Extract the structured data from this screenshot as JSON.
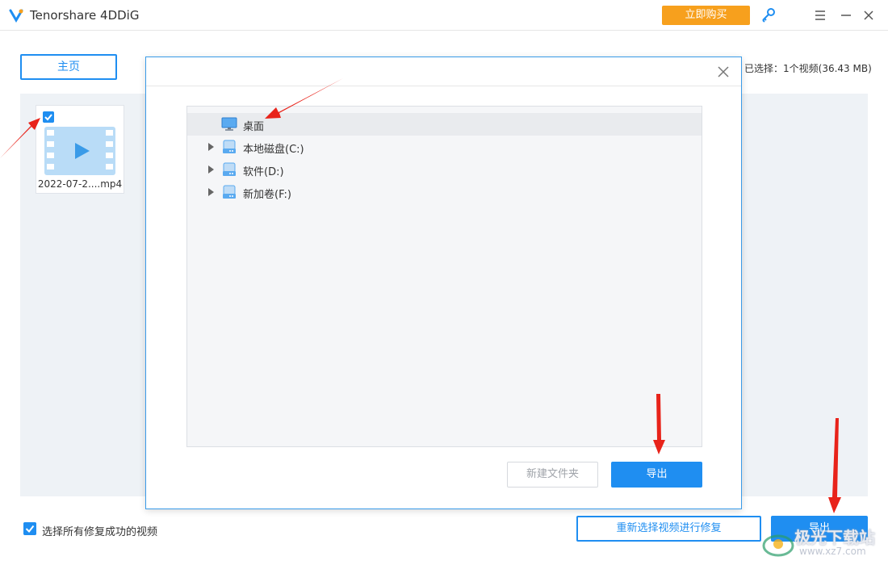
{
  "window": {
    "title": "Tenorshare 4DDiG",
    "buy_button": "立即购买"
  },
  "main": {
    "home_button": "主页",
    "selected_info": "已选择：1个视频(36.43 MB)",
    "video_card": {
      "file_name": "2022-07-2....mp4",
      "checked": true
    }
  },
  "footer": {
    "select_all_label": "选择所有修复成功的视频",
    "select_all_checked": true,
    "reselect_button": "重新选择视频进行修复",
    "export_button": "导出"
  },
  "dialog": {
    "tree": [
      {
        "label": "桌面",
        "icon": "desktop-icon",
        "expandable": false,
        "selected": true
      },
      {
        "label": "本地磁盘(C:)",
        "icon": "drive-icon",
        "expandable": true,
        "selected": false
      },
      {
        "label": "软件(D:)",
        "icon": "drive-icon",
        "expandable": true,
        "selected": false
      },
      {
        "label": "新加卷(F:)",
        "icon": "drive-icon",
        "expandable": true,
        "selected": false
      }
    ],
    "new_folder_button": "新建文件夹",
    "export_button": "导出"
  },
  "watermark": {
    "text": "极光下载站",
    "url": "www.xz7.com"
  },
  "colors": {
    "accent": "#1f8ef1",
    "buy": "#f7a01d",
    "annotation": "#e8231a"
  }
}
